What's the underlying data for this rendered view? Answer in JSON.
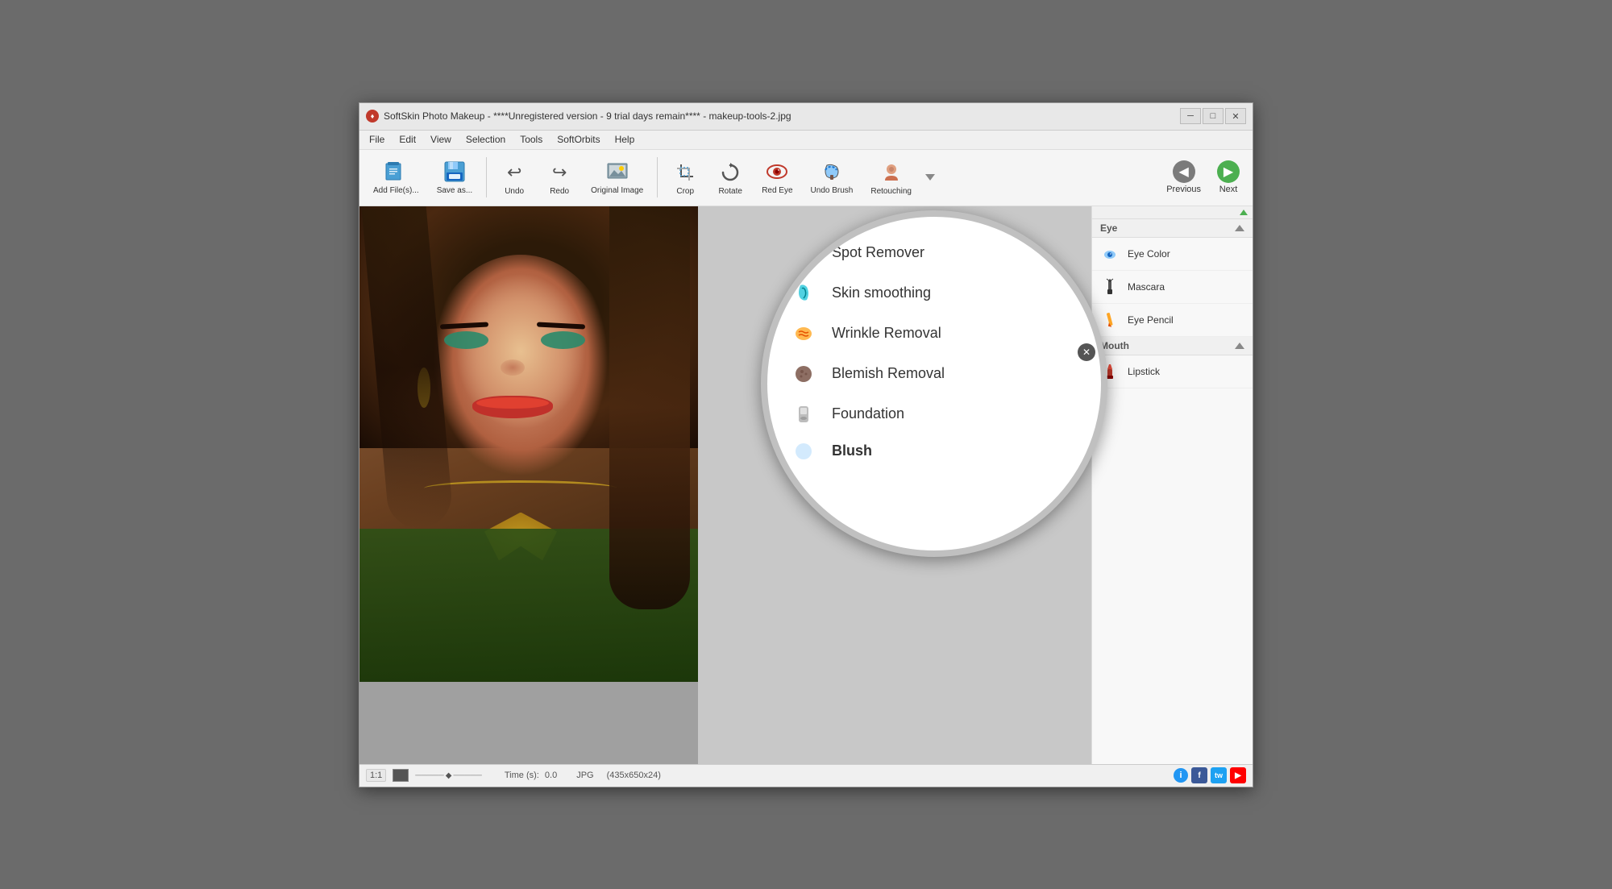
{
  "window": {
    "title": "SoftSkin Photo Makeup - ****Unregistered version - 9 trial days remain**** - makeup-tools-2.jpg",
    "app_icon": "♦"
  },
  "title_controls": {
    "minimize": "─",
    "maximize": "□",
    "close": "✕"
  },
  "menu": {
    "items": [
      "File",
      "Edit",
      "View",
      "Selection",
      "Tools",
      "SoftOrbits",
      "Help"
    ]
  },
  "toolbar": {
    "buttons": [
      {
        "id": "add-files",
        "icon": "📁",
        "label": "Add\nFile(s)..."
      },
      {
        "id": "save-as",
        "icon": "💾",
        "label": "Save\nas..."
      },
      {
        "id": "undo",
        "icon": "↩",
        "label": "Undo"
      },
      {
        "id": "redo",
        "icon": "↪",
        "label": "Redo"
      },
      {
        "id": "original-image",
        "icon": "🖼",
        "label": "Original\nImage"
      },
      {
        "id": "crop",
        "icon": "⊡",
        "label": "Crop"
      },
      {
        "id": "rotate",
        "icon": "↻",
        "label": "Rotate"
      },
      {
        "id": "red-eye",
        "icon": "👁",
        "label": "Red\nEye"
      },
      {
        "id": "undo-brush",
        "icon": "✏",
        "label": "Undo\nBrush"
      },
      {
        "id": "retouching",
        "icon": "👤",
        "label": "Retouching"
      }
    ],
    "nav": {
      "previous_label": "Previous",
      "next_label": "Next"
    }
  },
  "magnifier": {
    "items": [
      {
        "id": "spot-remover",
        "icon": "👤",
        "label": "Spot Remover",
        "icon_color": "#c0392b"
      },
      {
        "id": "skin-smoothing",
        "icon": "💧",
        "label": "Skin smoothing",
        "icon_color": "#27ae60"
      },
      {
        "id": "wrinkle-removal",
        "icon": "✨",
        "label": "Wrinkle Removal",
        "icon_color": "#f39c12"
      },
      {
        "id": "blemish-removal",
        "icon": "⬤",
        "label": "Blemish Removal",
        "icon_color": "#795548"
      },
      {
        "id": "foundation",
        "icon": "",
        "label": "Foundation",
        "icon_color": "#9e9e9e"
      }
    ],
    "blush_label": "Blush"
  },
  "right_panel": {
    "sections": [
      {
        "id": "eye",
        "title": "Eye",
        "items": [
          {
            "id": "eye-color",
            "icon": "💧",
            "label": "Eye Color"
          },
          {
            "id": "mascara",
            "icon": "✏",
            "label": "Mascara"
          },
          {
            "id": "eye-pencil",
            "icon": "✎",
            "label": "Eye Pencil"
          }
        ]
      },
      {
        "id": "mouth",
        "title": "Mouth",
        "items": [
          {
            "id": "lipstick",
            "icon": "💄",
            "label": "Lipstick"
          }
        ]
      }
    ]
  },
  "status_bar": {
    "zoom": "1:1",
    "time_label": "Time (s):",
    "time_value": "0.0",
    "format": "JPG",
    "dimensions": "(435x650x24)",
    "info_icon": "i",
    "fb_icon": "f",
    "tw_icon": "t",
    "yt_icon": "▶"
  }
}
